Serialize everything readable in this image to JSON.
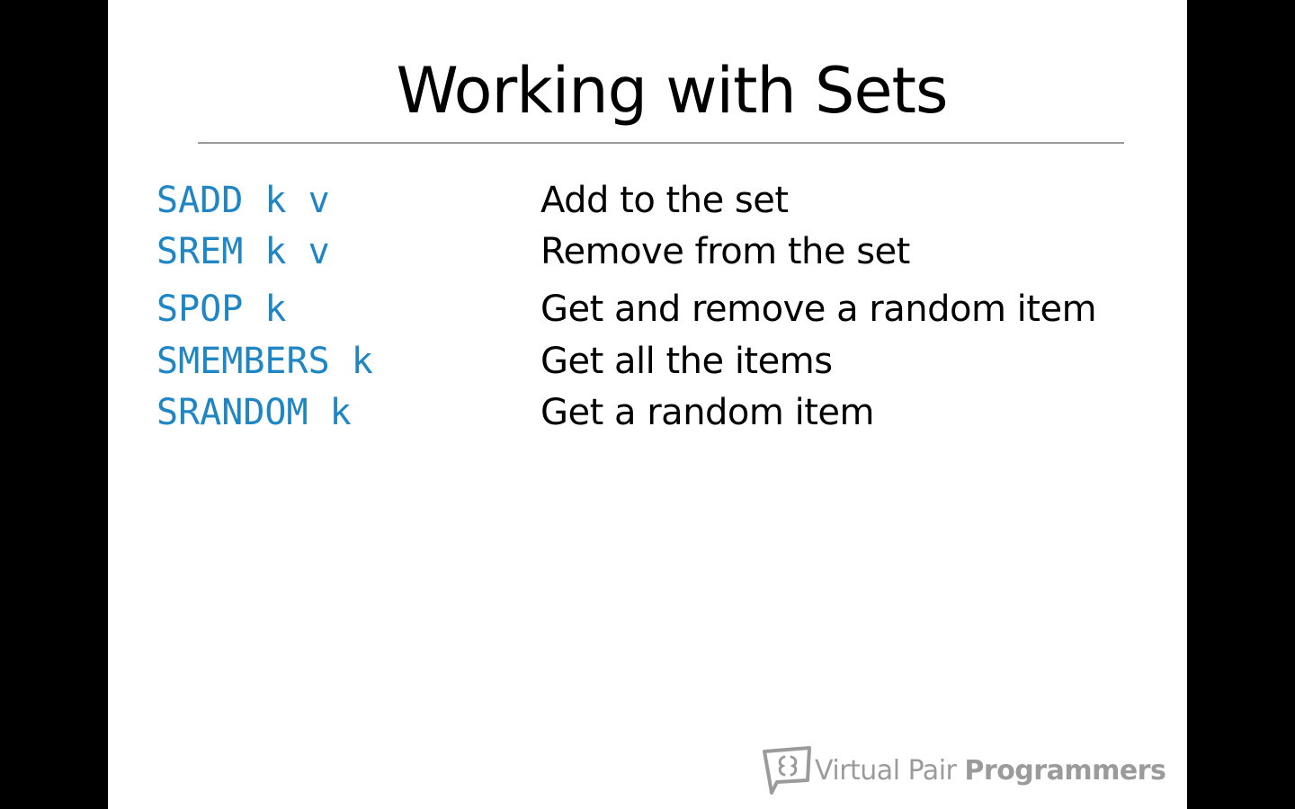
{
  "slide": {
    "title": "Working with Sets",
    "commands": [
      {
        "command": "SADD k v",
        "description": "Add to the set"
      },
      {
        "command": "SREM k v",
        "description": "Remove from the set"
      },
      {
        "command": "SPOP k",
        "description": "Get and remove a random item"
      },
      {
        "command": "SMEMBERS k",
        "description": "Get all the items"
      },
      {
        "command": "SRANDOM k",
        "description": "Get a random item"
      }
    ],
    "logo": {
      "light_text": "Virtual Pair",
      "bold_text": "Programmers",
      "icon": "speech-bubbles-logo-icon"
    }
  },
  "colors": {
    "background": "#000000",
    "slide": "#ffffff",
    "command": "#1f86c6",
    "rule": "#9a9a9a",
    "logo": "#9b9b9b"
  }
}
